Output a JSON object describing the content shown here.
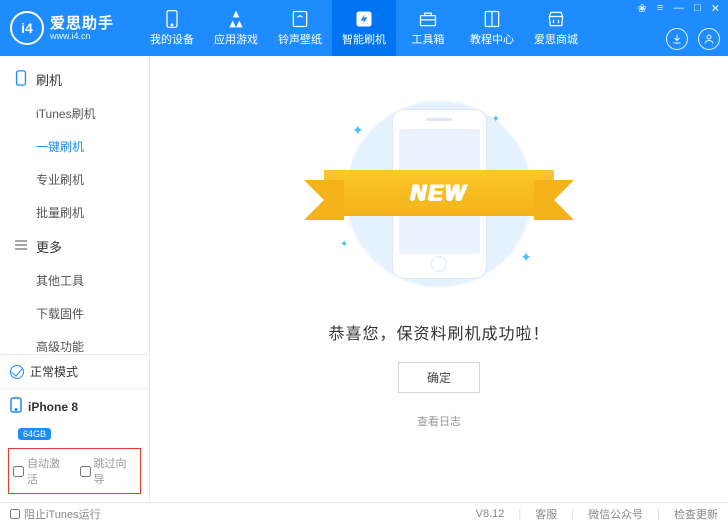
{
  "brand": {
    "name": "爱思助手",
    "subtitle": "www.i4.cn",
    "logo_text": "i4"
  },
  "nav": [
    {
      "label": "我的设备",
      "icon": "phone"
    },
    {
      "label": "应用游戏",
      "icon": "apps"
    },
    {
      "label": "铃声壁纸",
      "icon": "music"
    },
    {
      "label": "智能刷机",
      "icon": "flash",
      "active": true
    },
    {
      "label": "工具箱",
      "icon": "toolbox"
    },
    {
      "label": "教程中心",
      "icon": "book"
    },
    {
      "label": "爱思商城",
      "icon": "store"
    }
  ],
  "window_controls": {
    "settings": "❀",
    "menu": "≡",
    "min": "—",
    "max": "□",
    "close": "✕"
  },
  "sidebar": {
    "groups": [
      {
        "title": "刷机",
        "icon": "phone-outline",
        "items": [
          {
            "label": "iTunes刷机"
          },
          {
            "label": "一键刷机",
            "active": true
          },
          {
            "label": "专业刷机"
          },
          {
            "label": "批量刷机"
          }
        ]
      },
      {
        "title": "更多",
        "icon": "menu-lines",
        "items": [
          {
            "label": "其他工具"
          },
          {
            "label": "下载固件"
          },
          {
            "label": "高级功能"
          }
        ]
      }
    ],
    "status": {
      "label": "正常模式"
    },
    "device": {
      "name": "iPhone 8",
      "capacity": "64GB"
    },
    "options": {
      "auto_activate": "自动激活",
      "skip_wizard": "跳过向导"
    }
  },
  "content": {
    "ribbon_text": "NEW",
    "success_msg": "恭喜您，保资料刷机成功啦！",
    "ok_button": "确定",
    "view_log": "查看日志"
  },
  "footer": {
    "block_itunes": "阻止iTunes运行",
    "version": "V8.12",
    "links": [
      "客服",
      "微信公众号",
      "检查更新"
    ]
  }
}
